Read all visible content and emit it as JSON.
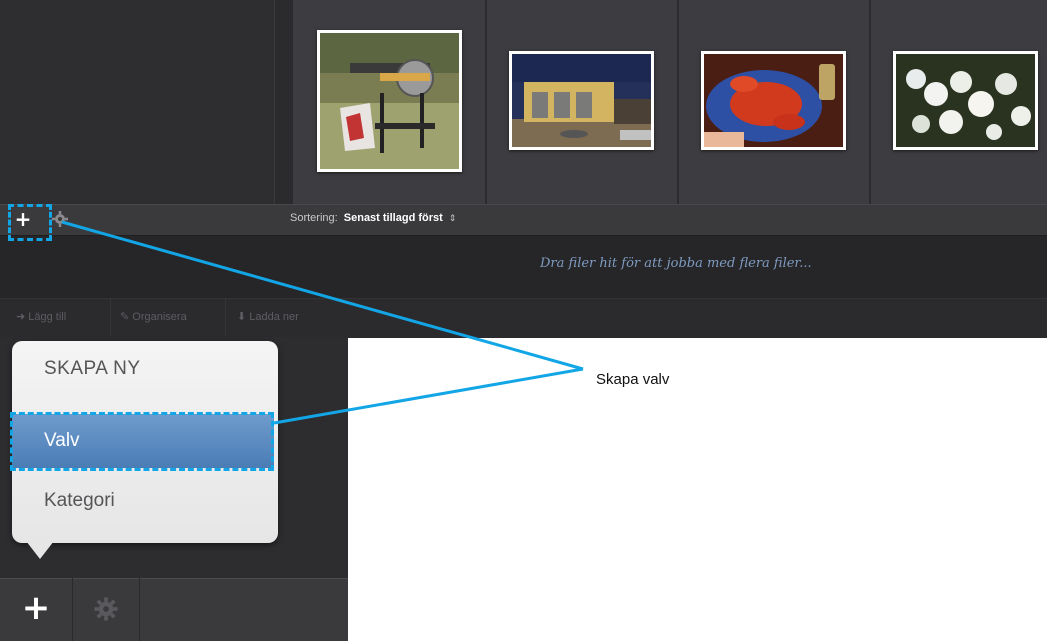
{
  "toolbar": {
    "add_label": "+",
    "sort_label": "Sortering:",
    "sort_value": "Senast tillagd först",
    "sort_arrows": "⇕"
  },
  "drop_zone": {
    "text": "Dra filer hit för att jobba med flera filer..."
  },
  "actions": [
    {
      "label": "Lägg till",
      "icon": "arrow-right-icon"
    },
    {
      "label": "Organisera",
      "icon": "wand-icon"
    },
    {
      "label": "Ladda ner",
      "icon": "download-icon"
    }
  ],
  "popup": {
    "header": "SKAPA NY",
    "items": [
      {
        "label": "Valv",
        "selected": true
      },
      {
        "label": "Kategori",
        "selected": false
      }
    ]
  },
  "bottom_bar": {
    "add_label": "+"
  },
  "callout": {
    "label": "Skapa valv",
    "color": "#13a6e6"
  },
  "thumbnails": [
    {
      "subject": "saw-on-stand"
    },
    {
      "subject": "yellow-garage"
    },
    {
      "subject": "lobsters"
    },
    {
      "subject": "white-blossoms"
    }
  ]
}
